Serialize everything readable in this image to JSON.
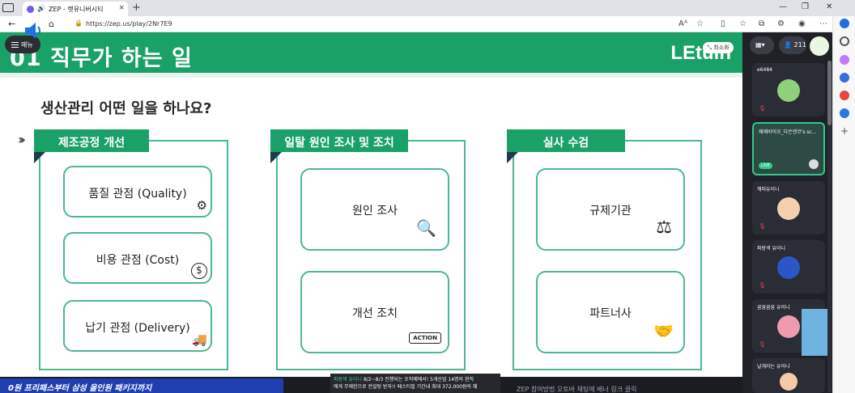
{
  "browser": {
    "tab_title": "ZEP - 렛유니버시티",
    "tab_close": "×",
    "new_tab": "+",
    "url": "https://zep.us/play/2Nr7E9",
    "window_controls": [
      "—",
      "❐",
      "✕"
    ]
  },
  "zep": {
    "menu_label": "메뉴",
    "minimize_label": "최소화",
    "participant_count": "211",
    "participants": [
      {
        "name": "e6484",
        "active": false
      },
      {
        "name": "제제바이오_다은엔코's sc...",
        "active": true
      },
      {
        "name": "해피유이니",
        "active": false
      },
      {
        "name": "파랑색 유이니",
        "active": false
      },
      {
        "name": "꿈꿈꿈꿈 유이니",
        "active": false
      },
      {
        "name": "날개라는 유이니",
        "active": false
      }
    ],
    "active_badge": "LIVE"
  },
  "slide": {
    "title": "01 직무가 하는 일",
    "brand": "LEtuin",
    "question": "생산관리 어떤 일을 하나요?",
    "columns": [
      {
        "tag": "제조공정 개선",
        "items": [
          {
            "label": "품질 관점 (Quality)",
            "icon": "quality-badge-icon"
          },
          {
            "label": "비용 관점 (Cost)",
            "icon": "dollar-down-icon"
          },
          {
            "label": "납기 관점 (Delivery)",
            "icon": "truck-icon"
          }
        ]
      },
      {
        "tag": "일탈 원인 조사 및 조치",
        "items": [
          {
            "label": "원인 조사",
            "icon": "document-search-icon"
          },
          {
            "label": "개선 조치",
            "icon": "action-button-icon",
            "icon_text": "ACTION"
          }
        ]
      },
      {
        "tag": "실사 수검",
        "items": [
          {
            "label": "규제기관",
            "icon": "scales-icon"
          },
          {
            "label": "파트너사",
            "icon": "handshake-icon"
          }
        ]
      }
    ]
  },
  "bottom": {
    "banner_left": "0원 프리패스부터 삼성 올인원 패키지까지",
    "banner_mid_highlight": "파랑색 유이니",
    "banner_mid_line1": "8/2~8/3 진행되는 오직메에서! 5개산업 14명의 현직",
    "banner_mid_line2": "에게 무제한으로 컨설팅 받자!! 페스티벌 기간내 최대 372,000원의 혜",
    "banner_right": "ZEP 참여방법 오토바 채팅에 배너 링크 클릭"
  },
  "colors": {
    "header_green": "#1aa167",
    "panel_border": "#4cb891",
    "zep_dark": "#1f2126"
  }
}
